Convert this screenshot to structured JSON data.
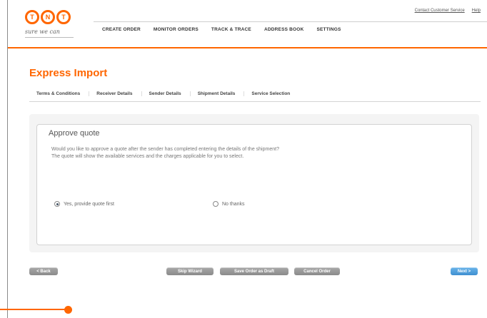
{
  "header": {
    "logo_letters": [
      "T",
      "N",
      "T"
    ],
    "tagline": "sure we can",
    "top_links": [
      "Contact Customer Service",
      "Help"
    ],
    "nav": [
      "CREATE ORDER",
      "MONITOR ORDERS",
      "TRACK & TRACE",
      "ADDRESS BOOK",
      "SETTINGS"
    ]
  },
  "page": {
    "title": "Express Import"
  },
  "steps": [
    "Terms & Conditions",
    "Receiver Details",
    "Sender Details",
    "Shipment Details",
    "Service Selection"
  ],
  "section": {
    "title": "Approve quote",
    "description_line1": "Would you like to approve a quote after the sender has completed entering the details of the shipment?",
    "description_line2": "The quote will show the available services and the charges applicable for you to select.",
    "options": [
      {
        "label": "Yes, provide quote first",
        "checked": true
      },
      {
        "label": "No thanks",
        "checked": false
      }
    ]
  },
  "buttons": {
    "back": "< Back",
    "skip_wizard": "Skip Wizard",
    "save_order_as_draft": "Save Order as Draft",
    "cancel_order": "Cancel Order",
    "next": "Next >"
  },
  "colors": {
    "accent": "#ff6600",
    "primary_button": "#4a9ad8",
    "secondary_button": "#999999"
  }
}
